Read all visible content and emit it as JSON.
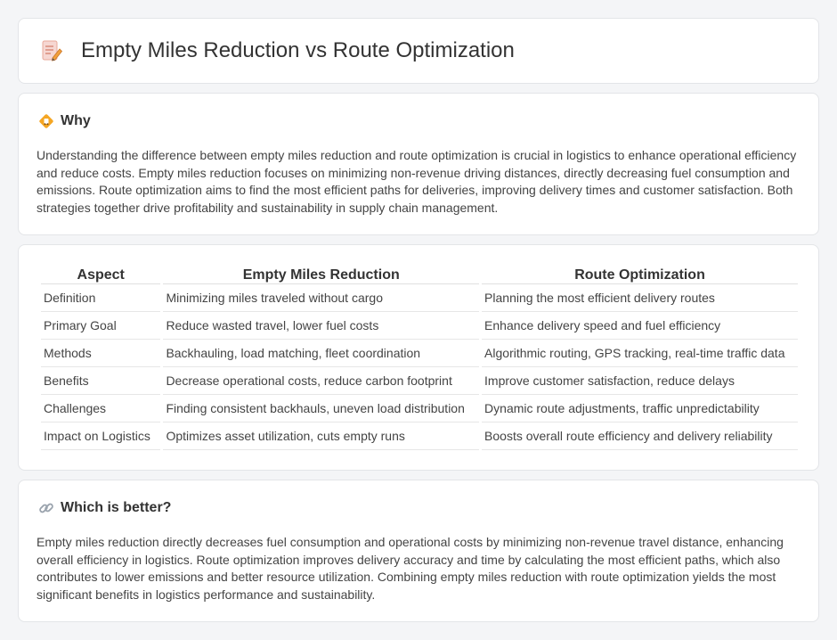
{
  "header": {
    "title": "Empty Miles Reduction vs Route Optimization",
    "icon": "document-pencil-icon"
  },
  "why": {
    "title": "Why",
    "icon": "warning-diamond-icon",
    "text": "Understanding the difference between empty miles reduction and route optimization is crucial in logistics to enhance operational efficiency and reduce costs. Empty miles reduction focuses on minimizing non-revenue driving distances, directly decreasing fuel consumption and emissions. Route optimization aims to find the most efficient paths for deliveries, improving delivery times and customer satisfaction. Both strategies together drive profitability and sustainability in supply chain management."
  },
  "table": {
    "headers": [
      "Aspect",
      "Empty Miles Reduction",
      "Route Optimization"
    ],
    "rows": [
      [
        "Definition",
        "Minimizing miles traveled without cargo",
        "Planning the most efficient delivery routes"
      ],
      [
        "Primary Goal",
        "Reduce wasted travel, lower fuel costs",
        "Enhance delivery speed and fuel efficiency"
      ],
      [
        "Methods",
        "Backhauling, load matching, fleet coordination",
        "Algorithmic routing, GPS tracking, real-time traffic data"
      ],
      [
        "Benefits",
        "Decrease operational costs, reduce carbon footprint",
        "Improve customer satisfaction, reduce delays"
      ],
      [
        "Challenges",
        "Finding consistent backhauls, uneven load distribution",
        "Dynamic route adjustments, traffic unpredictability"
      ],
      [
        "Impact on Logistics",
        "Optimizes asset utilization, cuts empty runs",
        "Boosts overall route efficiency and delivery reliability"
      ]
    ]
  },
  "better": {
    "title": "Which is better?",
    "icon": "link-icon",
    "text": "Empty miles reduction directly decreases fuel consumption and operational costs by minimizing non-revenue travel distance, enhancing overall efficiency in logistics. Route optimization improves delivery accuracy and time by calculating the most efficient paths, which also contributes to lower emissions and better resource utilization. Combining empty miles reduction with route optimization yields the most significant benefits in logistics performance and sustainability."
  },
  "colors": {
    "background": "#f4f5f7",
    "card": "#ffffff",
    "accent_orange": "#f0a030",
    "icon_pink": "#e57373"
  }
}
